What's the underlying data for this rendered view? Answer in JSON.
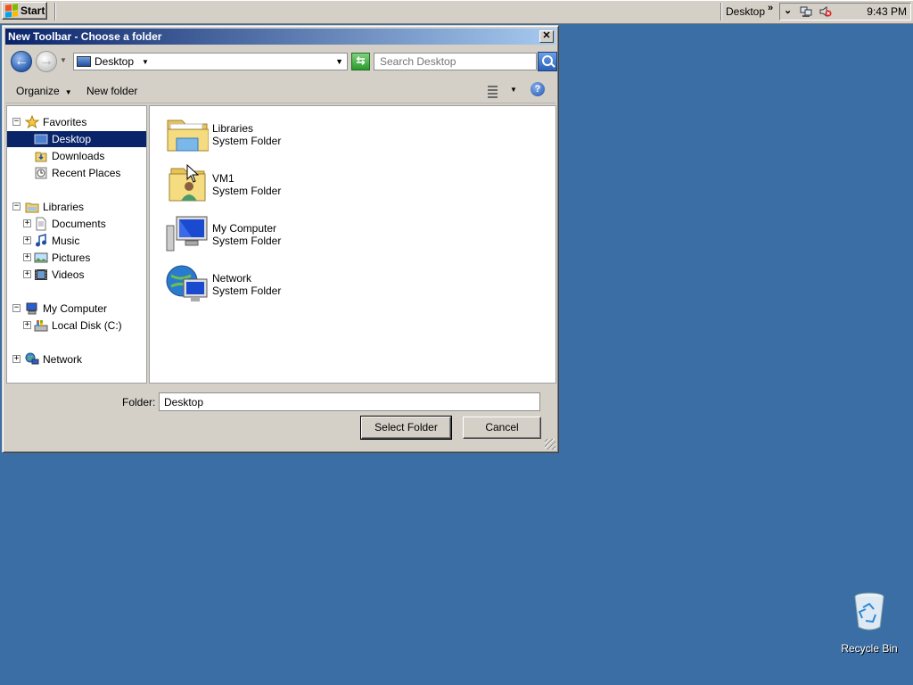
{
  "taskbar": {
    "start_label": "Start",
    "toolbar_label": "Desktop",
    "chevron": "»",
    "tray_expand": "⌄",
    "clock": "9:43 PM",
    "tray_icons": [
      "network-icon",
      "volume-muted-icon"
    ]
  },
  "dialog": {
    "title": "New Toolbar - Choose a folder",
    "close_glyph": "✕",
    "address": {
      "location": "Desktop",
      "search_placeholder": "Search Desktop"
    },
    "commands": {
      "organize": "Organize",
      "new_folder": "New folder",
      "help": "?"
    },
    "tree": [
      {
        "label": "Favorites",
        "level": 0,
        "expander": "−",
        "icon": "star-icon"
      },
      {
        "label": "Desktop",
        "level": 1,
        "icon": "desktop-icon",
        "selected": true
      },
      {
        "label": "Downloads",
        "level": 1,
        "icon": "downloads-icon"
      },
      {
        "label": "Recent Places",
        "level": 1,
        "icon": "recent-places-icon"
      },
      {
        "label": "Libraries",
        "level": 0,
        "expander": "−",
        "icon": "libraries-icon"
      },
      {
        "label": "Documents",
        "level": 1,
        "expander": "+",
        "icon": "documents-icon"
      },
      {
        "label": "Music",
        "level": 1,
        "expander": "+",
        "icon": "music-icon"
      },
      {
        "label": "Pictures",
        "level": 1,
        "expander": "+",
        "icon": "pictures-icon"
      },
      {
        "label": "Videos",
        "level": 1,
        "expander": "+",
        "icon": "videos-icon"
      },
      {
        "label": "My Computer",
        "level": 0,
        "expander": "−",
        "icon": "computer-icon"
      },
      {
        "label": "Local Disk (C:)",
        "level": 1,
        "expander": "+",
        "icon": "local-disk-icon"
      },
      {
        "label": "Network",
        "level": 0,
        "expander": "+",
        "icon": "network-icon"
      }
    ],
    "items": [
      {
        "name": "Libraries",
        "type": "System Folder",
        "icon": "libraries-folder-icon"
      },
      {
        "name": "VM1",
        "type": "System Folder",
        "icon": "user-folder-icon"
      },
      {
        "name": "My Computer",
        "type": "System Folder",
        "icon": "computer-icon"
      },
      {
        "name": "Network",
        "type": "System Folder",
        "icon": "network-globe-icon"
      }
    ],
    "folder_label": "Folder:",
    "folder_value": "Desktop",
    "select_button": "Select Folder",
    "cancel_button": "Cancel"
  },
  "desktop": {
    "recycle_bin_label": "Recycle Bin"
  }
}
